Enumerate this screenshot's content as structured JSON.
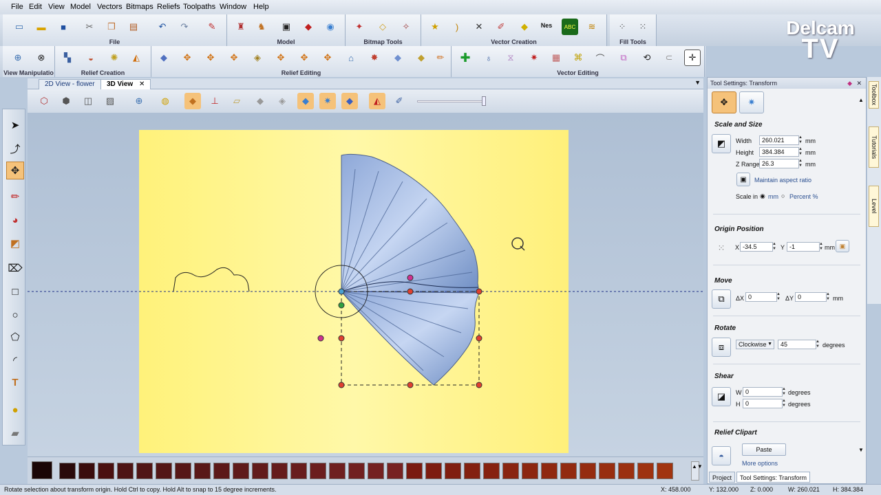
{
  "menu": [
    "File",
    "Edit",
    "View",
    "Model",
    "Vectors",
    "Bitmaps",
    "Reliefs",
    "Toolpaths",
    "Window",
    "Help"
  ],
  "toolbar_groups_row1": [
    "File",
    "Model",
    "Bitmap Tools",
    "Vector Creation",
    "Fill Tools"
  ],
  "toolbar_groups_row2": [
    "View Manipulatio",
    "Relief Creation",
    "Relief Editing",
    "Vector Editing"
  ],
  "logo": {
    "line1": "Delcam",
    "line2": "TV"
  },
  "tabs": [
    {
      "label": "2D View - flower"
    },
    {
      "label": "3D View"
    }
  ],
  "panel": {
    "title": "Tool Settings: Transform",
    "scale_and_size": {
      "heading": "Scale and Size",
      "width_label": "Width",
      "width": "260.021",
      "height_label": "Height",
      "height": "384.384",
      "zrange_label": "Z Range",
      "zrange": "26.3",
      "unit": "mm",
      "maintain": "Maintain aspect ratio",
      "scale_in": "Scale in",
      "opt_mm": "mm",
      "opt_percent": "Percent %"
    },
    "origin": {
      "heading": "Origin Position",
      "x_label": "X",
      "x": "-34.5",
      "y_label": "Y",
      "y": "-1",
      "unit": "mm"
    },
    "move": {
      "heading": "Move",
      "dx_label": "ΔX",
      "dx": "0",
      "dy_label": "ΔY",
      "dy": "0",
      "unit": "mm"
    },
    "rotate": {
      "heading": "Rotate",
      "direction": "Clockwise",
      "angle": "45",
      "unit": "degrees"
    },
    "shear": {
      "heading": "Shear",
      "w_label": "W",
      "w": "0",
      "h_label": "H",
      "h": "0",
      "unit": "degrees"
    },
    "relief_clipart": {
      "heading": "Relief Clipart",
      "paste": "Paste",
      "more": "More options"
    }
  },
  "panel_tabs": [
    "Project",
    "Tool Settings: Transform"
  ],
  "side_tabs": [
    "Toolbox",
    "Tutorials",
    "Level"
  ],
  "status": {
    "hint": "Rotate selection about transform origin.   Hold Ctrl to copy.  Hold Alt to snap to 15 degree increments.",
    "x": "X: 458.000",
    "y": "Y: 132.000",
    "z": "Z: 0.000",
    "w": "W: 260.021",
    "h": "H: 384.384"
  },
  "palette_colors": [
    "#2a0a0a",
    "#3a0d0d",
    "#4a1010",
    "#4d1414",
    "#501515",
    "#531616",
    "#561717",
    "#591818",
    "#5c1919",
    "#5f1a1a",
    "#621b1b",
    "#651c1c",
    "#681d1d",
    "#6b1e1e",
    "#6e1f1f",
    "#712020",
    "#742121",
    "#772222",
    "#7a1a10",
    "#7d1c10",
    "#801e10",
    "#832010",
    "#862210",
    "#892410",
    "#8c2610",
    "#8f2810",
    "#922a10",
    "#952c10",
    "#982e10",
    "#9b3010",
    "#9e3210",
    "#a13410"
  ]
}
